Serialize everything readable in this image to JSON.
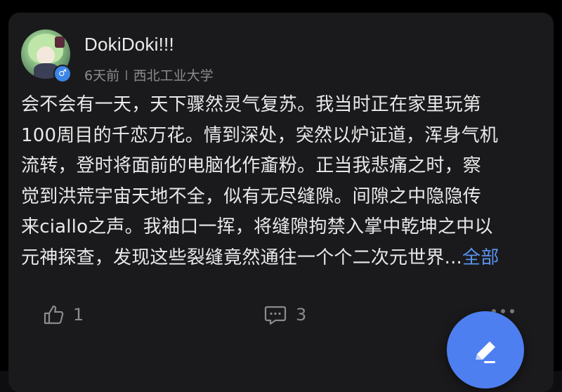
{
  "post": {
    "author": "DokiDoki!!!",
    "time": "6天前",
    "school": "西北工业大学",
    "gender_symbol": "♂",
    "lines": [
      "会不会有一天，天下骤然灵气复苏。我当时正在家里玩第",
      "100周目的千恋万花。情到深处，突然以炉证道，浑身气机",
      "流转，登时将面前的电脑化作齑粉。正当我悲痛之时，察",
      "觉到洪荒宇宙天地不全，似有无尽缝隙。间隙之中隐隐传",
      "来ciallo之声。我袖口一挥，将缝隙拘禁入掌中乾坤之中以",
      "元神探查，发现这些裂缝竟然通往一个个二次元世界..."
    ],
    "more_label": "全部",
    "like_count": "1",
    "comment_count": "3"
  },
  "icons": {
    "like": "thumbs-up-icon",
    "comment": "comment-bubble-icon",
    "more": "more-dots-icon",
    "fab": "edit-pencil-icon",
    "gender": "male-icon"
  },
  "colors": {
    "background": "#000000",
    "card": "#1a1a1c",
    "text": "#e9e9ea",
    "muted": "#8c8c8e",
    "link": "#5a93ee",
    "fab": "#4e7ff0",
    "gender_badge": "#3b86e8"
  }
}
